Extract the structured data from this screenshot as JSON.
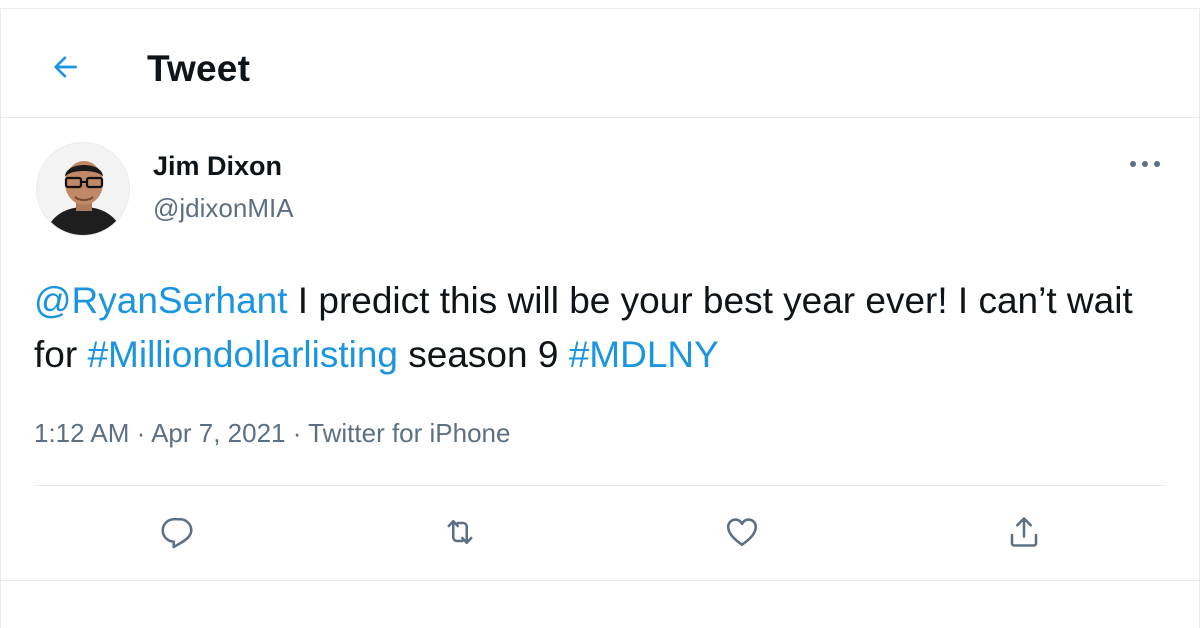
{
  "header": {
    "title": "Tweet",
    "back_icon": "arrow-left-icon",
    "accent_color": "#1b95e0"
  },
  "author": {
    "display_name": "Jim Dixon",
    "handle": "@jdixonMIA",
    "avatar": "profile-photo"
  },
  "tweet": {
    "segments": [
      {
        "text": "@RyanSerhant",
        "type": "mention"
      },
      {
        "text": " I predict this will be your best year ever! I can’t wait for ",
        "type": "text"
      },
      {
        "text": "#Milliondollarlisting",
        "type": "hashtag"
      },
      {
        "text": " season 9 ",
        "type": "text"
      },
      {
        "text": "#MDLNY",
        "type": "hashtag"
      }
    ]
  },
  "meta": {
    "time": "1:12 AM",
    "separator": " · ",
    "date": "Apr 7, 2021",
    "app": "Twitter for iPhone"
  },
  "actions": {
    "reply_icon": "reply-icon",
    "retweet_icon": "retweet-icon",
    "like_icon": "heart-icon",
    "share_icon": "share-icon",
    "more_icon": "more-icon"
  },
  "colors": {
    "text": "#0f1419",
    "secondary": "#5b7083",
    "link": "#1b95e0",
    "border": "#e6ecf0"
  }
}
